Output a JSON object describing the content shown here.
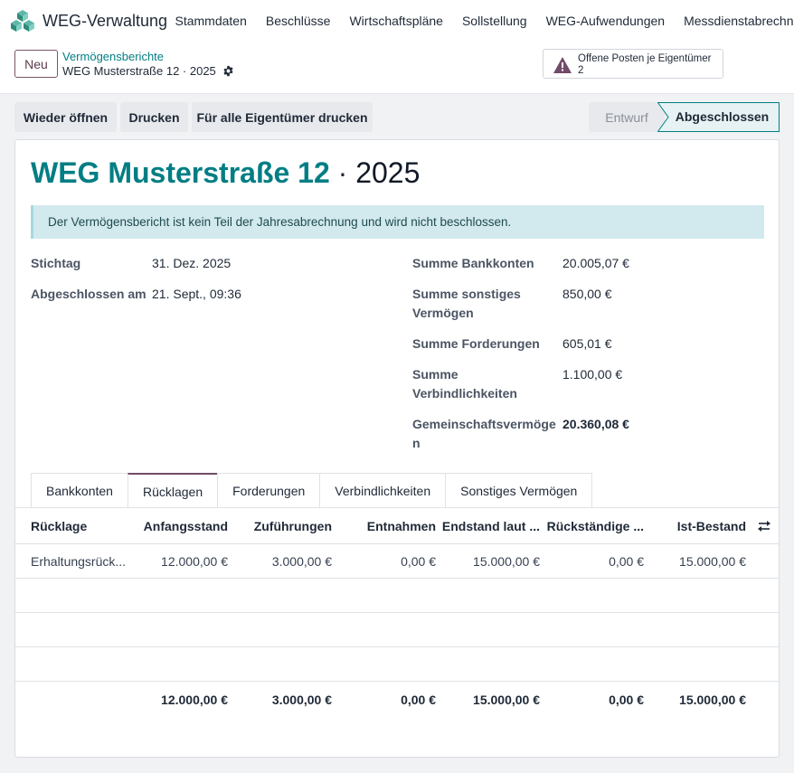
{
  "nav": {
    "app_title": "WEG-Verwaltung",
    "items": [
      "Stammdaten",
      "Beschlüsse",
      "Wirtschaftspläne",
      "Sollstellung",
      "WEG-Aufwendungen",
      "Messdienstabrechnu"
    ]
  },
  "control": {
    "new_label": "Neu",
    "breadcrumb": "Vermögensberichte",
    "record_name": "WEG Musterstraße 12 · 2025",
    "alert_label": "Offene Posten je Eigentümer",
    "alert_count": "2"
  },
  "actions": {
    "reopen": "Wieder öffnen",
    "print": "Drucken",
    "print_all": "Für alle Eigentümer drucken"
  },
  "status": {
    "draft": "Entwurf",
    "done": "Abgeschlossen",
    "current": "Abgeschlossen"
  },
  "form": {
    "title_name": "WEG Musterstraße 12",
    "title_sep": " · ",
    "title_year": "2025",
    "info": "Der Vermögensbericht ist kein Teil der Jahresabrechnung und wird nicht beschlossen.",
    "stichtag_label": "Stichtag",
    "stichtag_value": "31. Dez. 2025",
    "closed_label": "Abgeschlossen am",
    "closed_value": "21. Sept., 09:36",
    "bank_label": "Summe Bankkonten",
    "bank_value": "20.005,07 €",
    "other_label_1": "Summe sonstiges",
    "other_label_2": "Vermögen",
    "other_value": "850,00 €",
    "recv_label": "Summe Forderungen",
    "recv_value": "605,01 €",
    "liab_label_1": "Summe",
    "liab_label_2": "Verbindlichkeiten",
    "liab_value": "1.100,00 €",
    "common_label_1": "Gemeinschaftsvermöge",
    "common_label_2": "n",
    "common_value": "20.360,08 €"
  },
  "tabs": [
    "Bankkonten",
    "Rücklagen",
    "Forderungen",
    "Verbindlichkeiten",
    "Sonstiges Vermögen"
  ],
  "active_tab": "Rücklagen",
  "table": {
    "headers": [
      "Rücklage",
      "Anfangsstand",
      "Zuführungen",
      "Entnahmen",
      "Endstand laut ...",
      "Rückständige ...",
      "Ist-Bestand"
    ],
    "rows": [
      [
        "Erhaltungsrück...",
        "12.000,00 €",
        "3.000,00 €",
        "0,00 €",
        "15.000,00 €",
        "0,00 €",
        "15.000,00 €"
      ]
    ],
    "totals": [
      "",
      "12.000,00 €",
      "3.000,00 €",
      "0,00 €",
      "15.000,00 €",
      "0,00 €",
      "15.000,00 €"
    ]
  },
  "colors": {
    "accent": "#017e84",
    "brand": "#714b67",
    "info_bg": "#d2eaed"
  }
}
